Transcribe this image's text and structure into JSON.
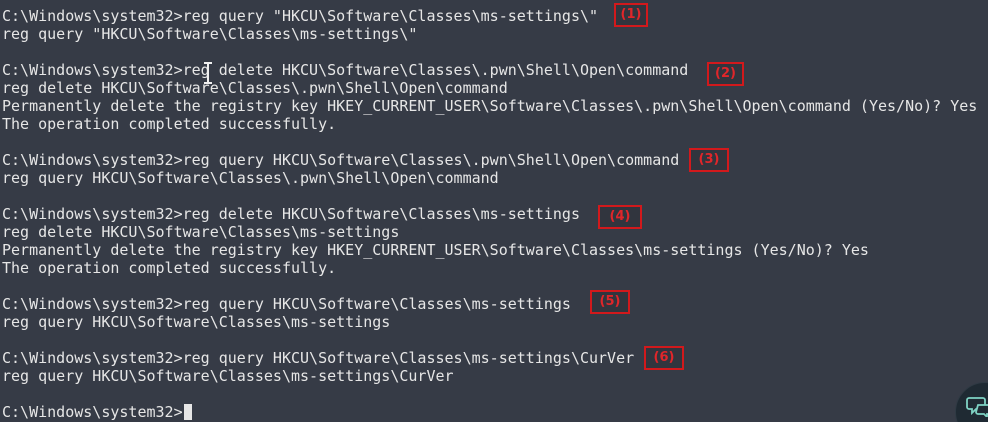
{
  "terminal": {
    "lines": [
      "C:\\Windows\\system32>reg query \"HKCU\\Software\\Classes\\ms-settings\\\"",
      "reg query \"HKCU\\Software\\Classes\\ms-settings\\\"",
      "",
      "C:\\Windows\\system32>reg delete HKCU\\Software\\Classes\\.pwn\\Shell\\Open\\command",
      "reg delete HKCU\\Software\\Classes\\.pwn\\Shell\\Open\\command",
      "Permanently delete the registry key HKEY_CURRENT_USER\\Software\\Classes\\.pwn\\Shell\\Open\\command (Yes/No)? Yes",
      "The operation completed successfully.",
      "",
      "C:\\Windows\\system32>reg query HKCU\\Software\\Classes\\.pwn\\Shell\\Open\\command",
      "reg query HKCU\\Software\\Classes\\.pwn\\Shell\\Open\\command",
      "",
      "C:\\Windows\\system32>reg delete HKCU\\Software\\Classes\\ms-settings",
      "reg delete HKCU\\Software\\Classes\\ms-settings",
      "Permanently delete the registry key HKEY_CURRENT_USER\\Software\\Classes\\ms-settings (Yes/No)? Yes",
      "The operation completed successfully.",
      "",
      "C:\\Windows\\system32>reg query HKCU\\Software\\Classes\\ms-settings",
      "reg query HKCU\\Software\\Classes\\ms-settings",
      "",
      "C:\\Windows\\system32>reg query HKCU\\Software\\Classes\\ms-settings\\CurVer",
      "reg query HKCU\\Software\\Classes\\ms-settings\\CurVer",
      "",
      "C:\\Windows\\system32>"
    ]
  },
  "annotations": {
    "a1": "(1)",
    "a2": "(2)",
    "a3": "(3)",
    "a4": "(4)",
    "a5": "(5)",
    "a6": "(6)"
  },
  "colors": {
    "background": "#363b46",
    "text": "#e6e6e6",
    "annotation": "#d2191c"
  },
  "icons": {
    "chat_button": "chat-bubble-icon",
    "mouse_pointer": "text-cursor-ibeam"
  }
}
